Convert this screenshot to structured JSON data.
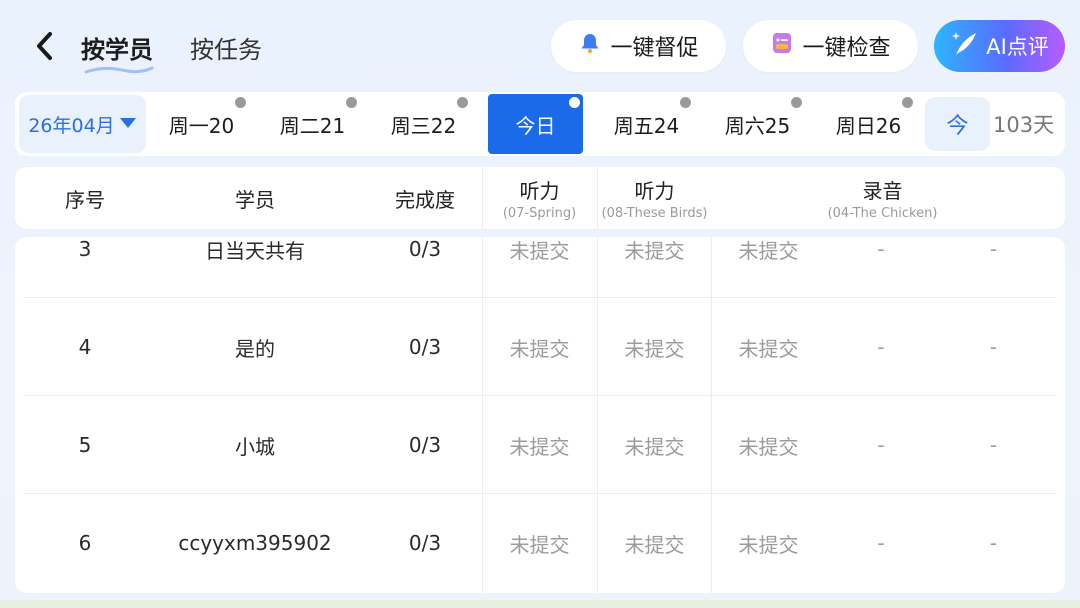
{
  "header": {
    "tab_by_student": "按学员",
    "tab_by_task": "按任务",
    "remind_label": "一键督促",
    "check_label": "一键检查",
    "ai_label": "AI点评"
  },
  "datebar": {
    "month": "26年04月",
    "days": [
      {
        "label": "周一20",
        "dot": true
      },
      {
        "label": "周二21",
        "dot": true
      },
      {
        "label": "周三22",
        "dot": true
      },
      {
        "label": "今日",
        "dot": true,
        "active": true
      },
      {
        "label": "周五24",
        "dot": true
      },
      {
        "label": "周六25",
        "dot": true
      },
      {
        "label": "周日26",
        "dot": true
      }
    ],
    "today_button": "今",
    "days_count": "103天"
  },
  "table": {
    "headers": {
      "index": "序号",
      "student": "学员",
      "completion": "完成度",
      "listen1": "听力",
      "listen1_sub": "(07-Spring)",
      "listen2": "听力",
      "listen2_sub": "(08-These Birds)",
      "record": "录音",
      "record_sub": "(04-The Chicken)"
    },
    "rows": [
      {
        "index": "3",
        "student": "日当天共有",
        "completion": "0/3",
        "c1": "未提交",
        "c2": "未提交",
        "c3": "未提交",
        "c4": "-",
        "c5": "-"
      },
      {
        "index": "4",
        "student": "是的",
        "completion": "0/3",
        "c1": "未提交",
        "c2": "未提交",
        "c3": "未提交",
        "c4": "-",
        "c5": "-"
      },
      {
        "index": "5",
        "student": "小城",
        "completion": "0/3",
        "c1": "未提交",
        "c2": "未提交",
        "c3": "未提交",
        "c4": "-",
        "c5": "-"
      },
      {
        "index": "6",
        "student": "ccyyxm395902",
        "completion": "0/3",
        "c1": "未提交",
        "c2": "未提交",
        "c3": "未提交",
        "c4": "-",
        "c5": "-"
      }
    ]
  },
  "colors": {
    "accent": "#1b6ae9",
    "muted_text": "#9b9b9b",
    "background": "#eaf2fd"
  }
}
